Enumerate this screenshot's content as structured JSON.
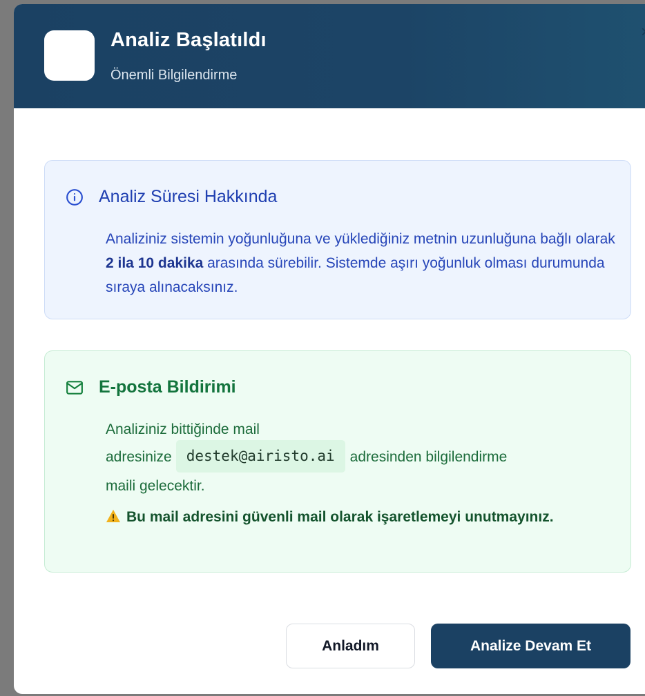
{
  "header": {
    "title": "Analiz Başlatıldı",
    "subtitle": "Önemli Bilgilendirme",
    "close_icon": "close-icon"
  },
  "info_card": {
    "icon": "info-circle-icon",
    "title": "Analiz Süresi Hakkında",
    "text_part1": "Analiziniz sistemin yoğunluğuna ve yüklediğiniz metnin uzunluğuna bağlı olarak ",
    "text_bold": "2 ila 10 dakika",
    "text_part2": " arasında sürebilir. Sistemde aşırı yoğunluk olması durumunda sıraya alınacaksınız.",
    "colors": {
      "background": "#eef4fe",
      "text": "#2645b8"
    }
  },
  "mail_card": {
    "icon": "mail-envelope-icon",
    "title": "E-posta Bildirimi",
    "text_line1": "Analiziniz bittiğinde mail",
    "text_before_email": "adresinize",
    "email": "destek@airisto.ai",
    "text_after_email": "adresinden bilgilendirme",
    "text_line3": "maili gelecektir.",
    "warning_icon": "warning-triangle-icon",
    "warning": "Bu mail adresini güvenli mail olarak işaretlemeyi unutmayınız.",
    "colors": {
      "background": "#eefcf3",
      "text": "#1b6b3a"
    }
  },
  "buttons": {
    "secondary_label": "Anladım",
    "primary_label": "Analize Devam Et"
  },
  "colors": {
    "header_bg": "#1b4163",
    "primary_button": "#1b4163"
  }
}
